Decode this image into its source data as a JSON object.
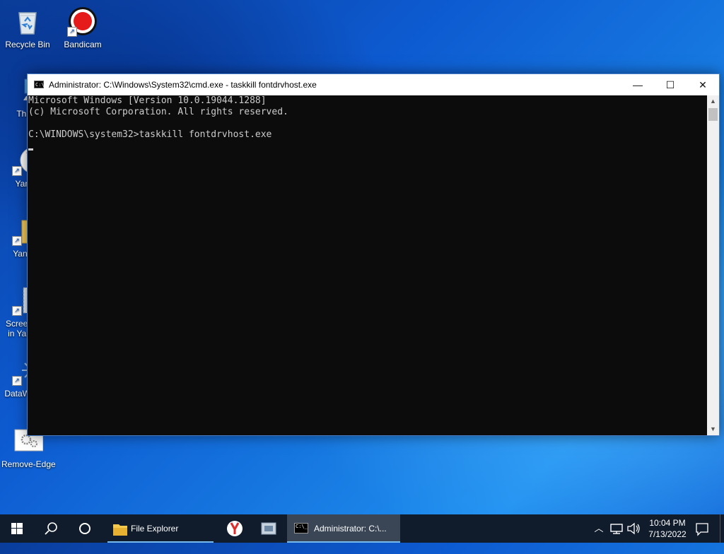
{
  "desktop": {
    "icons": [
      {
        "label": "Recycle Bin"
      },
      {
        "label": "Bandicam"
      },
      {
        "label": "This"
      },
      {
        "label": "Yan"
      },
      {
        "label": "Yande"
      },
      {
        "label": "Screen"
      },
      {
        "label": "in Yan"
      },
      {
        "label": "DataW"
      },
      {
        "label": "Remove-Edge"
      }
    ]
  },
  "window": {
    "title": "Administrator: C:\\Windows\\System32\\cmd.exe - taskkill  fontdrvhost.exe",
    "minimize_glyph": "—",
    "maximize_glyph": "☐",
    "close_glyph": "✕",
    "console_lines": [
      "Microsoft Windows [Version 10.0.19044.1288]",
      "(c) Microsoft Corporation. All rights reserved.",
      "",
      "C:\\WINDOWS\\system32>taskkill fontdrvhost.exe"
    ]
  },
  "taskbar": {
    "file_explorer_label": "File Explorer",
    "cmd_label": "Administrator: C:\\...",
    "time": "10:04 PM",
    "date": "7/13/2022"
  },
  "colors": {
    "console_bg": "#0c0c0c",
    "console_text": "#cccccc",
    "taskbar_bg": "#101c2c",
    "accent": "#76b9ed"
  }
}
